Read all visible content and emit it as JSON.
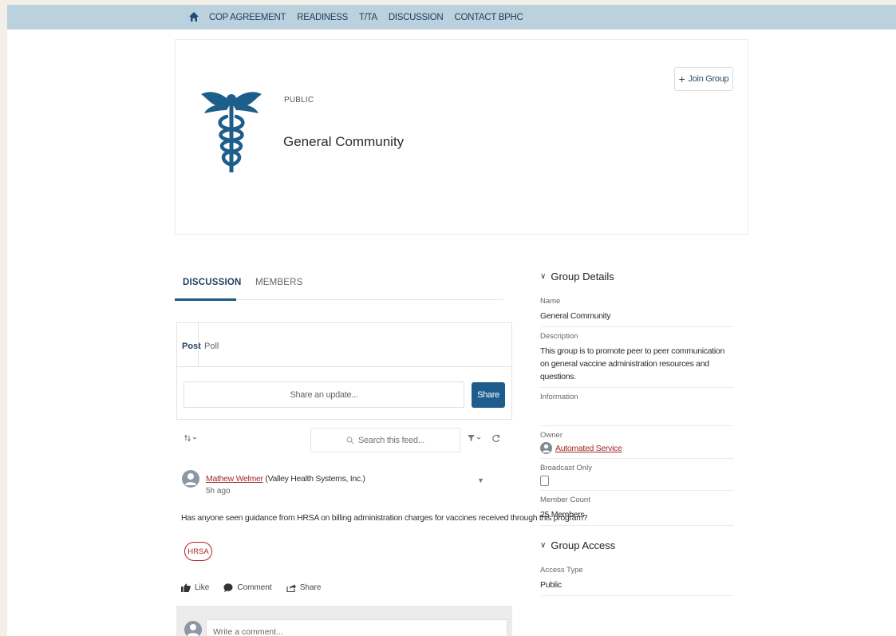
{
  "nav": {
    "home_icon": "home-icon",
    "items": [
      "COP AGREEMENT",
      "READINESS",
      "T/TA",
      "DISCUSSION",
      "CONTACT BPHC"
    ]
  },
  "group": {
    "visibility": "PUBLIC",
    "title": "General Community",
    "join_label": "Join Group",
    "logo_icon": "caduceus-icon"
  },
  "tabs": {
    "discussion": "DISCUSSION",
    "members": "MEMBERS"
  },
  "publisher": {
    "tab_post": "Post",
    "tab_poll": "Poll",
    "placeholder": "Share an update...",
    "share_label": "Share"
  },
  "feed_controls": {
    "search_placeholder": "Search this feed..."
  },
  "post": {
    "author": "Mathew Welmer",
    "org": " (Valley Health Systems, Inc.)",
    "time": "5h ago",
    "body": "Has anyone seen guidance from HRSA on billing administration charges for vaccines received through this program?",
    "topic": "HRSA",
    "like": "Like",
    "comment": "Comment",
    "share": "Share",
    "comment_placeholder": "Write a comment..."
  },
  "details": {
    "heading": "Group Details",
    "name_label": "Name",
    "name_value": "General Community",
    "description_label": "Description",
    "description_value": "This group is to promote peer to peer communication on general vaccine administration resources and questions.",
    "information_label": "Information",
    "owner_label": "Owner",
    "owner_value": "Automated Service",
    "broadcast_label": "Broadcast Only",
    "member_count_label": "Member Count",
    "member_count_value": "25 Members"
  },
  "access": {
    "heading": "Group Access",
    "access_type_label": "Access Type",
    "access_type_value": "Public"
  },
  "colors": {
    "nav_bg": "#bcd1de",
    "accent": "#1f5c8e",
    "link": "#a52a2a",
    "logo": "#1d5e8a"
  }
}
